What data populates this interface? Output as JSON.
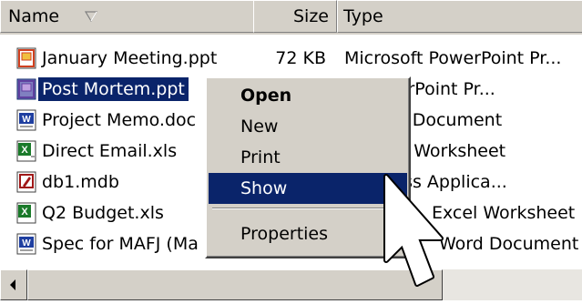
{
  "header": {
    "name_label": "Name",
    "size_label": "Size",
    "type_label": "Type"
  },
  "files": [
    {
      "name": "January Meeting.ppt",
      "size": "72 KB",
      "type": "Microsoft PowerPoint Pr...",
      "icon": "powerpoint-file-icon"
    },
    {
      "name": "Post Mortem.ppt",
      "size": "",
      "type": "ft PowerPoint Pr...",
      "icon": "powerpoint-file-icon"
    },
    {
      "name": "Project Memo.doc",
      "size": "",
      "type": "ft Word Document",
      "icon": "word-file-icon"
    },
    {
      "name": "Direct Email.xls",
      "size": "",
      "type": "ft Excel Worksheet",
      "icon": "excel-file-icon"
    },
    {
      "name": "db1.mdb",
      "size": "",
      "type": "ft Access Applica...",
      "icon": "access-file-icon"
    },
    {
      "name": "Q2 Budget.xls",
      "size": "",
      "type": "Excel Worksheet",
      "icon": "excel-file-icon"
    },
    {
      "name": "Spec for MAFJ (Ma",
      "size": "",
      "type": "Word Document",
      "icon": "word-file-icon"
    }
  ],
  "context_menu": {
    "open": "Open",
    "new": "New",
    "print": "Print",
    "show": "Show",
    "properties": "Properties"
  },
  "colors": {
    "selection": "#0a246a",
    "chrome": "#d4d0c8",
    "powerpoint": "#d04020",
    "word": "#1f3fa0",
    "excel": "#1a7a2a",
    "access": "#a01818"
  }
}
